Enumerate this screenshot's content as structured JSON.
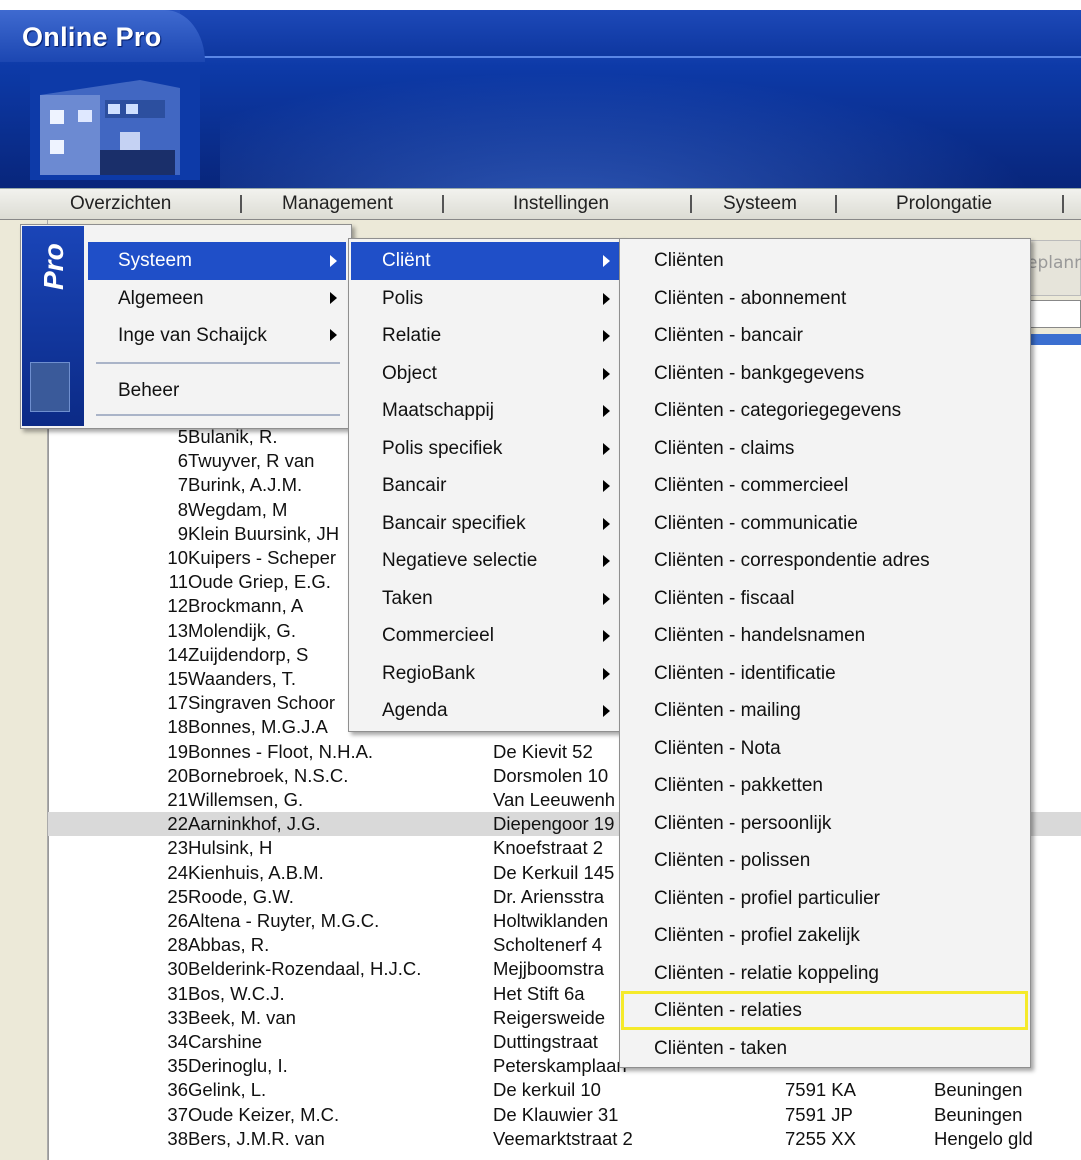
{
  "app": {
    "title": "Online Pro"
  },
  "menubar": {
    "items": [
      "Overzichten",
      "Management",
      "Instellingen",
      "Systeem",
      "Prolongatie"
    ]
  },
  "side_brand": "Pro",
  "right_panel": {
    "text": "eplann"
  },
  "menu_level1": {
    "items": [
      {
        "label": "Systeem",
        "has_submenu": true,
        "highlighted": true
      },
      {
        "label": "Algemeen",
        "has_submenu": true
      },
      {
        "label": "Inge van Schaijck",
        "has_submenu": true
      },
      {
        "label": "Beheer",
        "has_submenu": false
      }
    ]
  },
  "menu_level2": {
    "items": [
      {
        "label": "Cliënt",
        "has_submenu": true,
        "highlighted": true
      },
      {
        "label": "Polis",
        "has_submenu": true
      },
      {
        "label": "Relatie",
        "has_submenu": true
      },
      {
        "label": "Object",
        "has_submenu": true
      },
      {
        "label": "Maatschappij",
        "has_submenu": true
      },
      {
        "label": "Polis specifiek",
        "has_submenu": true
      },
      {
        "label": "Bancair",
        "has_submenu": true
      },
      {
        "label": "Bancair specifiek",
        "has_submenu": true
      },
      {
        "label": "Negatieve selectie",
        "has_submenu": true
      },
      {
        "label": "Taken",
        "has_submenu": true
      },
      {
        "label": "Commercieel",
        "has_submenu": true
      },
      {
        "label": "RegioBank",
        "has_submenu": true
      },
      {
        "label": "Agenda",
        "has_submenu": true
      }
    ]
  },
  "menu_level3": {
    "items": [
      "Cliënten",
      "Cliënten - abonnement",
      "Cliënten - bancair",
      "Cliënten - bankgegevens",
      "Cliënten - categoriegegevens",
      "Cliënten - claims",
      "Cliënten - commercieel",
      "Cliënten - communicatie",
      "Cliënten - correspondentie adres",
      "Cliënten - fiscaal",
      "Cliënten - handelsnamen",
      "Cliënten - identificatie",
      "Cliënten - mailing",
      "Cliënten - Nota",
      "Cliënten - pakketten",
      "Cliënten - persoonlijk",
      "Cliënten - polissen",
      "Cliënten - profiel particulier",
      "Cliënten - profiel zakelijk",
      "Cliënten - relatie koppeling",
      "Cliënten - relaties",
      "Cliënten - taken"
    ],
    "emphasized": "Cliënten - relaties"
  },
  "table": {
    "rows": [
      {
        "num": "5",
        "name": "Bulanik, R.",
        "addr": "",
        "zip": "",
        "city": ""
      },
      {
        "num": "6",
        "name": "Twuyver, R van",
        "addr": "",
        "zip": "",
        "city": ""
      },
      {
        "num": "7",
        "name": "Burink, A.J.M.",
        "addr": "",
        "zip": "",
        "city": ""
      },
      {
        "num": "8",
        "name": "Wegdam, M",
        "addr": "",
        "zip": "",
        "city": ""
      },
      {
        "num": "9",
        "name": "Klein Buursink, JH",
        "addr": "",
        "zip": "",
        "city": ""
      },
      {
        "num": "10",
        "name": "Kuipers - Scheper",
        "addr": "",
        "zip": "",
        "city": ""
      },
      {
        "num": "11",
        "name": "Oude Griep, E.G.",
        "addr": "",
        "zip": "",
        "city": ""
      },
      {
        "num": "12",
        "name": "Brockmann, A",
        "addr": "",
        "zip": "",
        "city": ""
      },
      {
        "num": "13",
        "name": "Molendijk, G.",
        "addr": "",
        "zip": "",
        "city": ""
      },
      {
        "num": "14",
        "name": "Zuijdendorp, S",
        "addr": "",
        "zip": "",
        "city": ""
      },
      {
        "num": "15",
        "name": "Waanders, T.",
        "addr": "",
        "zip": "",
        "city": ""
      },
      {
        "num": "17",
        "name": "Singraven Schoor",
        "addr": "",
        "zip": "",
        "city": ""
      },
      {
        "num": "18",
        "name": "Bonnes, M.G.J.A",
        "addr": "",
        "zip": "",
        "city": ""
      },
      {
        "num": "19",
        "name": "Bonnes - Floot, N.H.A.",
        "addr": "De Kievit 52",
        "zip": "",
        "city": ""
      },
      {
        "num": "20",
        "name": "Bornebroek, N.S.C.",
        "addr": "Dorsmolen 10",
        "zip": "",
        "city": ""
      },
      {
        "num": "21",
        "name": "Willemsen, G.",
        "addr": "Van Leeuwenh",
        "zip": "",
        "city": ""
      },
      {
        "num": "22",
        "name": "Aarninkhof, J.G.",
        "addr": "Diepengoor 19",
        "zip": "",
        "city": "",
        "selected": true
      },
      {
        "num": "23",
        "name": "Hulsink, H",
        "addr": "Knoefstraat 2",
        "zip": "",
        "city": ""
      },
      {
        "num": "24",
        "name": "Kienhuis, A.B.M.",
        "addr": "De Kerkuil 145",
        "zip": "",
        "city": ""
      },
      {
        "num": "25",
        "name": "Roode, G.W.",
        "addr": "Dr. Ariensstra",
        "zip": "",
        "city": ""
      },
      {
        "num": "26",
        "name": "Altena - Ruyter, M.G.C.",
        "addr": "Holtwiklanden",
        "zip": "",
        "city": ""
      },
      {
        "num": "28",
        "name": "Abbas, R.",
        "addr": "Scholtenerf 4",
        "zip": "",
        "city": ""
      },
      {
        "num": "30",
        "name": "Belderink-Rozendaal, H.J.C.",
        "addr": "Mejjboomstra",
        "zip": "",
        "city": ""
      },
      {
        "num": "31",
        "name": "Bos, W.C.J.",
        "addr": "Het Stift 6a",
        "zip": "",
        "city": ""
      },
      {
        "num": "33",
        "name": "Beek, M. van",
        "addr": "Reigersweide",
        "zip": "",
        "city": ""
      },
      {
        "num": "34",
        "name": "Carshine",
        "addr": "Duttingstraat",
        "zip": "",
        "city": ""
      },
      {
        "num": "35",
        "name": "Derinoglu, I.",
        "addr": "Peterskamplaan",
        "zip": "",
        "city": ""
      },
      {
        "num": "36",
        "name": "Gelink, L.",
        "addr": "De kerkuil 10",
        "zip": "7591 KA",
        "city": "Beuningen"
      },
      {
        "num": "37",
        "name": "Oude Keizer, M.C.",
        "addr": "De Klauwier 31",
        "zip": "7591 JP",
        "city": "Beuningen"
      },
      {
        "num": "38",
        "name": "Bers, J.M.R. van",
        "addr": "Veemarktstraat 2",
        "zip": "7255 XX",
        "city": "Hengelo gld"
      }
    ]
  },
  "colors": {
    "highlight": "#1f4fc8",
    "banner": "#0d3aa8",
    "emphasis_box": "#f5ea2a",
    "selected_row": "#d9d9d9"
  }
}
